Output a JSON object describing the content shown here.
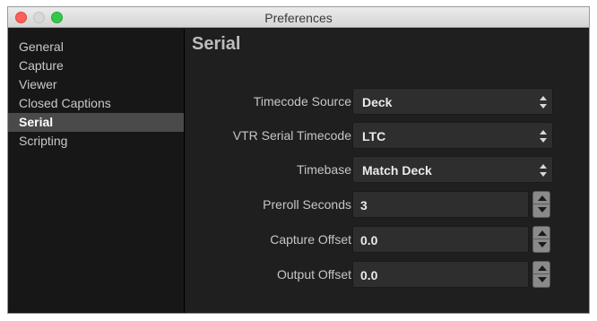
{
  "window": {
    "title": "Preferences"
  },
  "sidebar": {
    "items": [
      {
        "label": "General",
        "active": false
      },
      {
        "label": "Capture",
        "active": false
      },
      {
        "label": "Viewer",
        "active": false
      },
      {
        "label": "Closed Captions",
        "active": false
      },
      {
        "label": "Serial",
        "active": true
      },
      {
        "label": "Scripting",
        "active": false
      }
    ]
  },
  "main": {
    "title": "Serial",
    "timecode_source": {
      "label": "Timecode Source",
      "value": "Deck"
    },
    "vtr_serial_timecode": {
      "label": "VTR Serial Timecode",
      "value": "LTC"
    },
    "timebase": {
      "label": "Timebase",
      "value": "Match Deck"
    },
    "preroll_seconds": {
      "label": "Preroll Seconds",
      "value": "3"
    },
    "capture_offset": {
      "label": "Capture Offset",
      "value": "0.0"
    },
    "output_offset": {
      "label": "Output Offset",
      "value": "0.0"
    }
  },
  "colors": {
    "close": "#fc5f57",
    "maximize": "#34c84a",
    "sidebar_active": "#4a4a4a"
  }
}
